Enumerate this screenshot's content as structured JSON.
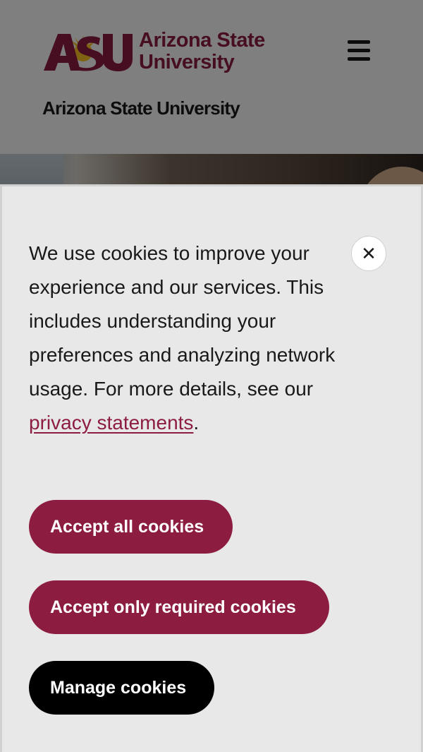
{
  "header": {
    "logo": {
      "mark_text": "ASU",
      "name_line1": "Arizona State",
      "name_line2": "University"
    },
    "menu_icon": "hamburger-icon",
    "site_title": "Arizona State University"
  },
  "cookie_banner": {
    "message": "We use cookies to improve your experience and our services. This includes understanding your preferences and analyzing network usage. For more details, see our ",
    "link_text": "privacy statements",
    "message_end": ".",
    "close_icon": "close-icon",
    "close_label": "✕",
    "buttons": {
      "accept_all": "Accept all cookies",
      "accept_required": "Accept only required cookies",
      "manage": "Manage cookies"
    }
  },
  "colors": {
    "brand_maroon": "#8c1d40",
    "brand_gold": "#ffc627",
    "banner_bg": "#e8e8e8",
    "text": "#191919"
  }
}
